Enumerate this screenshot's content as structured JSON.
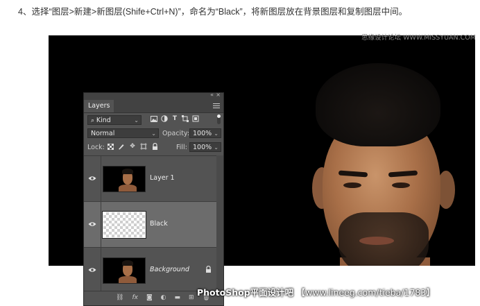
{
  "instruction": "4、选择“图层>新建>新图层(Shife+Ctrl+N)”，命名为“Black”，将新图层放在背景图层和复制图层中间。",
  "watermark_top": "思缘设计论坛 WWW.MISSYUAN.COM",
  "watermark_bottom": {
    "brand": "PhotoShop平面设计吧",
    "url": "【www.lineeg.com/tieba/1783】"
  },
  "layers_panel": {
    "collapse_icon": "«",
    "close_icon": "×",
    "tab_label": "Layers",
    "filter": {
      "kind_label": "Kind",
      "icons": [
        "image-filter-icon",
        "adjustment-filter-icon",
        "type-filter-icon",
        "shape-filter-icon",
        "smart-object-filter-icon"
      ]
    },
    "blend_mode": "Normal",
    "opacity_label": "Opacity:",
    "opacity_value": "100%",
    "lock_label": "Lock:",
    "fill_label": "Fill:",
    "fill_value": "100%",
    "layers": [
      {
        "name": "Layer 1",
        "visible": true,
        "thumbnail": "portrait",
        "selected": false,
        "locked": false
      },
      {
        "name": "Black",
        "visible": true,
        "thumbnail": "transparent",
        "selected": true,
        "locked": false
      },
      {
        "name": "Background",
        "visible": true,
        "thumbnail": "portrait",
        "selected": false,
        "locked": true
      }
    ],
    "bottom_icons": [
      "link-icon",
      "fx",
      "mask-icon",
      "adjustment-icon",
      "group-icon",
      "new-layer-icon",
      "trash-icon"
    ],
    "bottom_fx_label": "fx"
  },
  "colors": {
    "panel_bg": "#535353",
    "selected_layer": "#6c6c6c",
    "canvas_bg": "#000000"
  }
}
